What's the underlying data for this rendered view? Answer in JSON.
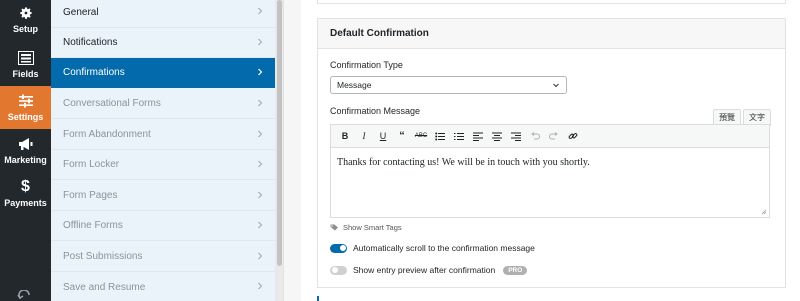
{
  "rail": {
    "items": [
      {
        "label": "Setup",
        "icon": "gear-icon"
      },
      {
        "label": "Fields",
        "icon": "list-icon"
      },
      {
        "label": "Settings",
        "icon": "sliders-icon",
        "active": true
      },
      {
        "label": "Marketing",
        "icon": "megaphone-icon"
      },
      {
        "label": "Payments",
        "icon": "dollar-icon"
      }
    ],
    "accent_color": "#e27730"
  },
  "submenu": {
    "items": [
      {
        "label": "General"
      },
      {
        "label": "Notifications"
      },
      {
        "label": "Confirmations",
        "active": true
      },
      {
        "label": "Conversational Forms"
      },
      {
        "label": "Form Abandonment"
      },
      {
        "label": "Form Locker"
      },
      {
        "label": "Form Pages"
      },
      {
        "label": "Offline Forms"
      },
      {
        "label": "Post Submissions"
      },
      {
        "label": "Save and Resume"
      }
    ],
    "active_color": "#036aab"
  },
  "panel": {
    "title": "Default Confirmation",
    "type_label": "Confirmation Type",
    "type_value": "Message",
    "message_label": "Confirmation Message",
    "tabs": [
      "預覽",
      "文字"
    ],
    "message_text": "Thanks for contacting us! We will be in touch with you shortly.",
    "smart_tags": "Show Smart Tags",
    "toggles": [
      {
        "label": "Automatically scroll to the confirmation message",
        "on": true
      },
      {
        "label": "Show entry preview after confirmation",
        "on": false,
        "badge": "PRO"
      }
    ]
  },
  "toolbar": {
    "buttons": [
      "bold-icon",
      "italic-icon",
      "underline-icon",
      "blockquote-icon",
      "strikethrough-icon",
      "bullet-list-icon",
      "numbered-list-icon",
      "align-left-icon",
      "align-center-icon",
      "align-right-icon",
      "undo-icon",
      "redo-icon",
      "link-icon"
    ]
  }
}
